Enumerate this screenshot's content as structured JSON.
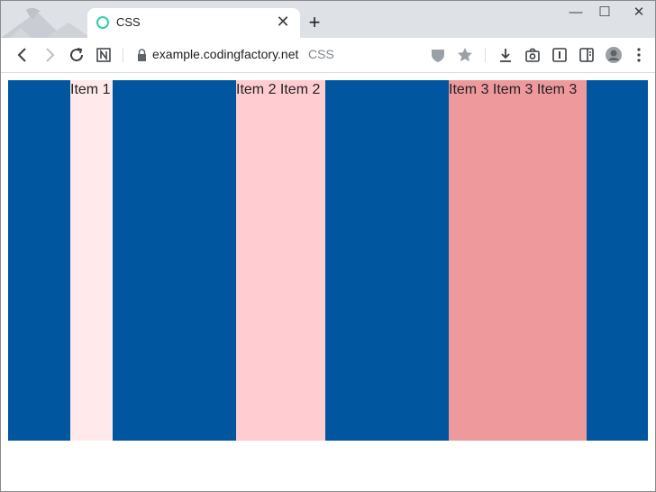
{
  "browser": {
    "tab_title": "CSS",
    "tab_close": "✕",
    "new_tab": "+",
    "url_domain": "example.codingfactory.net",
    "url_page": "CSS",
    "minimize": "—",
    "maximize": "☐",
    "close": "✕",
    "icons": [
      "back-icon",
      "forward-icon",
      "reload-icon",
      "notion-icon",
      "lock-icon",
      "shield-icon",
      "star-icon",
      "download-icon",
      "camera-icon",
      "reader-icon",
      "sidebar-icon",
      "avatar",
      "menu-icon"
    ]
  },
  "page": {
    "items": [
      {
        "label": "Item 1",
        "color": "#ffe9ea"
      },
      {
        "label": "Item 2 Item 2",
        "color": "#ffccd1"
      },
      {
        "label": "Item 3 Item 3 Item 3",
        "color": "#ee999c"
      }
    ],
    "container_color": "#00579f"
  }
}
